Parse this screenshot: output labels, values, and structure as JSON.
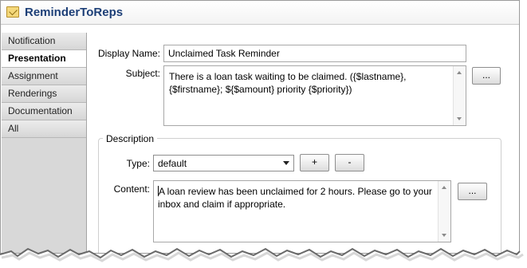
{
  "window": {
    "title": "ReminderToReps"
  },
  "tabs": [
    "Notification",
    "Presentation",
    "Assignment",
    "Renderings",
    "Documentation",
    "All"
  ],
  "active_tab_index": 1,
  "form": {
    "display_name_label": "Display Name:",
    "display_name_value": "Unclaimed Task Reminder",
    "subject_label": "Subject:",
    "subject_value": "There is a loan task waiting to be claimed. ({$lastname},\n{$firstname}; ${$amount} priority {$priority})",
    "subject_button": "...",
    "description_legend": "Description",
    "type_label": "Type:",
    "type_value": "default",
    "plus_button": "+",
    "minus_button": "-",
    "content_label": "Content:",
    "content_value": "A loan review has been unclaimed for 2 hours. Please go to your\ninbox and claim if appropriate.",
    "content_button": "..."
  }
}
